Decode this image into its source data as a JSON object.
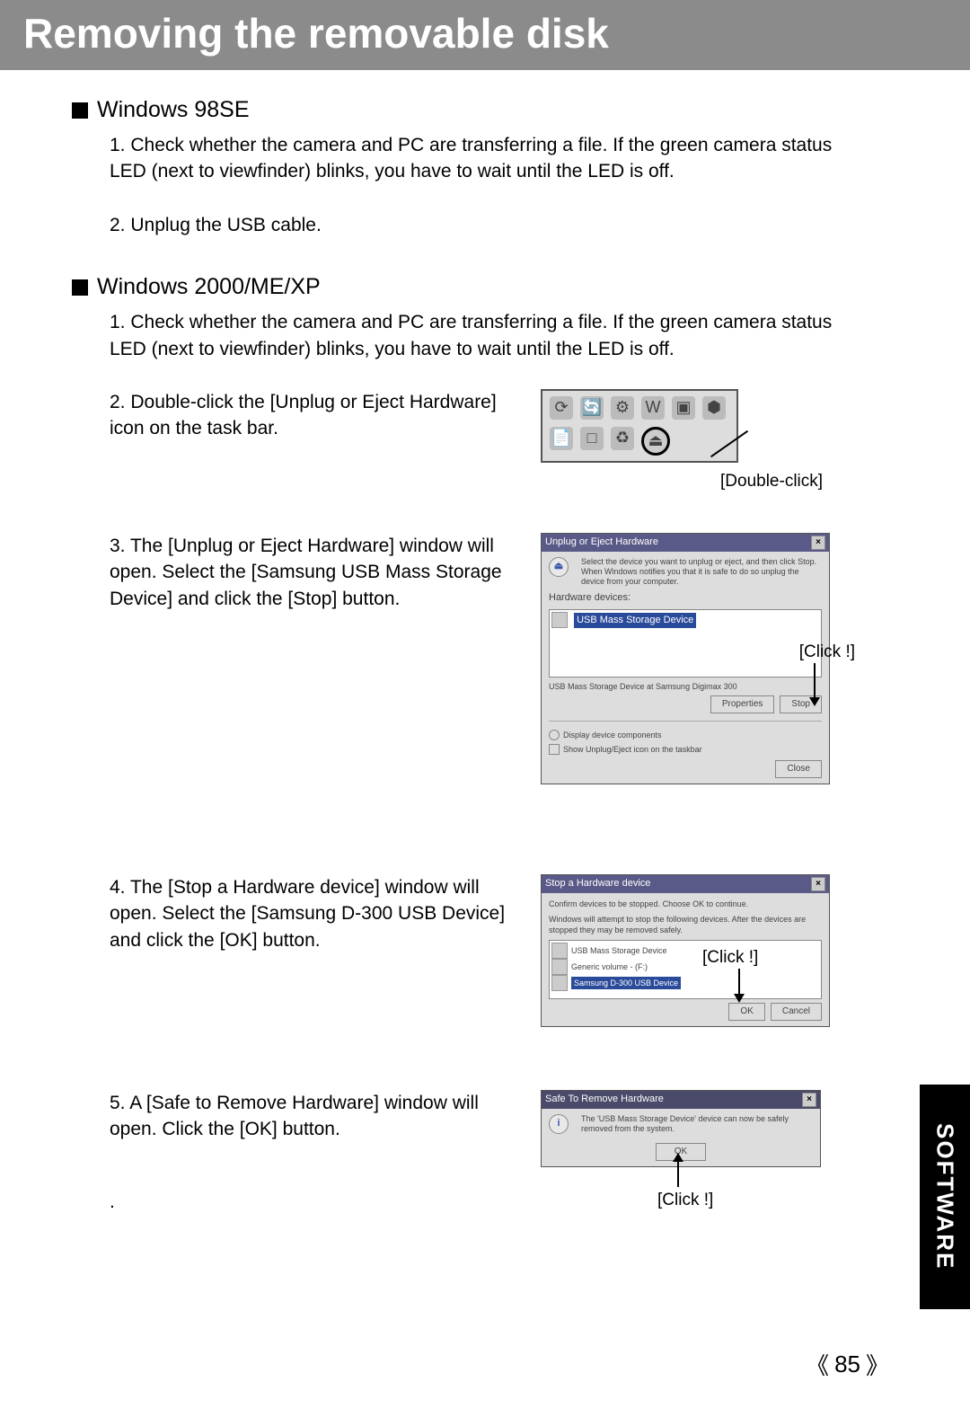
{
  "page": {
    "title": "Removing the removable disk",
    "number": "85",
    "side_tab": "SOFTWARE"
  },
  "section1": {
    "heading": "Windows 98SE",
    "steps": {
      "s1": "1. Check whether the camera and PC are transferring a file. If the green camera status LED (next to viewfinder) blinks, you have to wait until the LED is off.",
      "s2": "2. Unplug the USB cable."
    }
  },
  "section2": {
    "heading": "Windows 2000/ME/XP",
    "steps": {
      "s1": "1. Check whether the camera and PC are transferring a file. If the green camera status LED (next to viewfinder) blinks, you have to wait until the LED is off.",
      "s2": "2. Double-click the [Unplug or Eject Hardware] icon on the task bar.",
      "s3": "3. The [Unplug or Eject Hardware] window will open. Select the [Samsung USB Mass Storage Device] and click the [Stop] button.",
      "s4": "4. The [Stop a Hardware device] window will open. Select the [Samsung D-300 USB Device] and click the [OK] button.",
      "s5": "5. A [Safe to Remove Hardware] window will open. Click the [OK] button."
    }
  },
  "captions": {
    "dblclick": "[Double-click]",
    "click": "[Click !]"
  },
  "dialogs": {
    "unplug": {
      "title": "Unplug or Eject Hardware",
      "hint": "Select the device you want to unplug or eject, and then click Stop. When Windows notifies you that it is safe to do so unplug the device from your computer.",
      "label": "Hardware devices:",
      "item": "USB Mass Storage Device",
      "status": "USB Mass Storage Device at Samsung Digimax 300",
      "btn_props": "Properties",
      "btn_stop": "Stop",
      "opt1": "Display device components",
      "opt2": "Show Unplug/Eject icon on the taskbar",
      "btn_close": "Close"
    },
    "stop": {
      "title": "Stop a Hardware device",
      "hint": "Confirm devices to be stopped. Choose OK to continue.",
      "hint2": "Windows will attempt to stop the following devices. After the devices are stopped they may be removed safely.",
      "item1": "USB Mass Storage Device",
      "item2": "Generic volume - (F:)",
      "item3": "Samsung D-300 USB Device",
      "btn_ok": "OK",
      "btn_cancel": "Cancel"
    },
    "safe": {
      "title": "Safe To Remove Hardware",
      "msg": "The 'USB Mass Storage Device' device can now be safely removed from the system.",
      "btn_ok": "OK"
    }
  }
}
